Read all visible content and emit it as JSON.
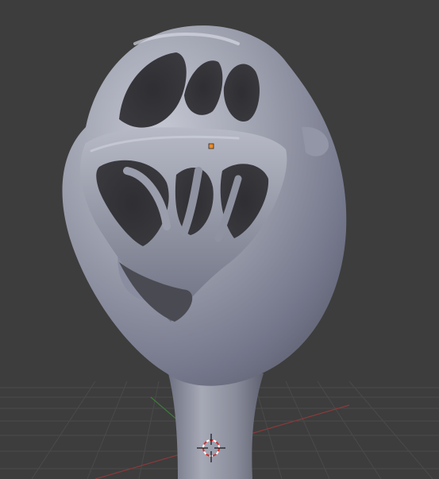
{
  "viewport": {
    "background_color": "#3d3d3d",
    "grid_line_color": "#4a4a4a",
    "grid_major_color": "#555555",
    "x_axis_color": "#8a3a3a",
    "y_axis_color": "#3f7a3f",
    "mesh_color": "#7e8190",
    "origin_color": "#f08a24"
  },
  "objects": [
    {
      "name": "sculpt-mesh",
      "shape": "cage-head-on-stem"
    },
    {
      "name": "object-origin",
      "icon": "origin-dot-icon"
    },
    {
      "name": "3d-cursor",
      "icon": "crosshair-icon"
    }
  ]
}
